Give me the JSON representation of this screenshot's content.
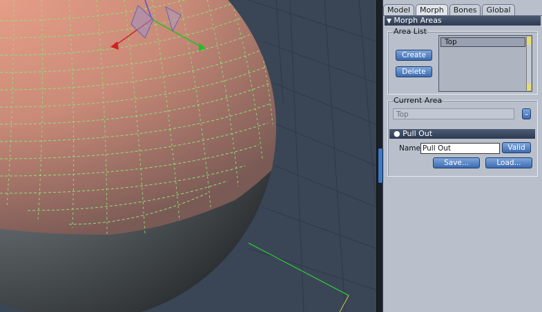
{
  "tabs": [
    "Model",
    "Morph",
    "Bones",
    "Global"
  ],
  "active_tab": "Morph",
  "section_header": "Morph Areas",
  "area_list": {
    "legend": "Area List",
    "create_label": "Create",
    "delete_label": "Delete",
    "items": [
      "Top"
    ]
  },
  "current_area": {
    "legend": "Current Area",
    "selected_value": "Top",
    "morph_header": "Pull Out",
    "name_label": "Name:",
    "name_value": "Pull Out",
    "valid_label": "Valid",
    "save_label": "Save...",
    "load_label": "Load..."
  },
  "colors": {
    "viewport_bg": "#3a4656",
    "grid_line": "#2d3949",
    "sphere_skin": "#d8907a",
    "mesh_green": "#8ee27a",
    "axis_red": "#d02020",
    "axis_green": "#20c020",
    "panel_bg": "#b9c0cc",
    "button_blue": "#3e6cb0"
  }
}
